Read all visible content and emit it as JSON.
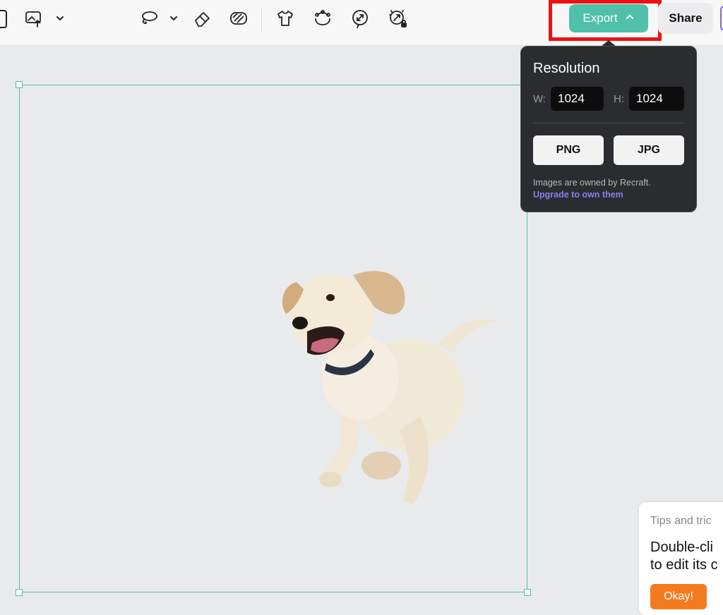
{
  "toolbar": {
    "icons": [
      "frame-edge-icon",
      "image-export-icon",
      "lasso-icon",
      "eraser-icon",
      "inpaint-icon",
      "shirt-icon",
      "face-points-icon",
      "vectorize-icon",
      "upscale-locked-icon"
    ],
    "export_label": "Export",
    "share_label": "Share",
    "accent_color": "#4fc0a9",
    "highlight_color": "#ee1111"
  },
  "export_popup": {
    "title": "Resolution",
    "width_label": "W:",
    "width_value": "1024",
    "height_label": "H:",
    "height_value": "1024",
    "formats": [
      "PNG",
      "JPG"
    ],
    "note": "Images are owned by Recraft.",
    "upgrade_link": "Upgrade to own them"
  },
  "canvas": {
    "image_subject": "running puppy cutout"
  },
  "tips": {
    "header": "Tips and tric",
    "line1": "Double-cli",
    "line2": "to edit its c",
    "okay_label": "Okay!"
  }
}
